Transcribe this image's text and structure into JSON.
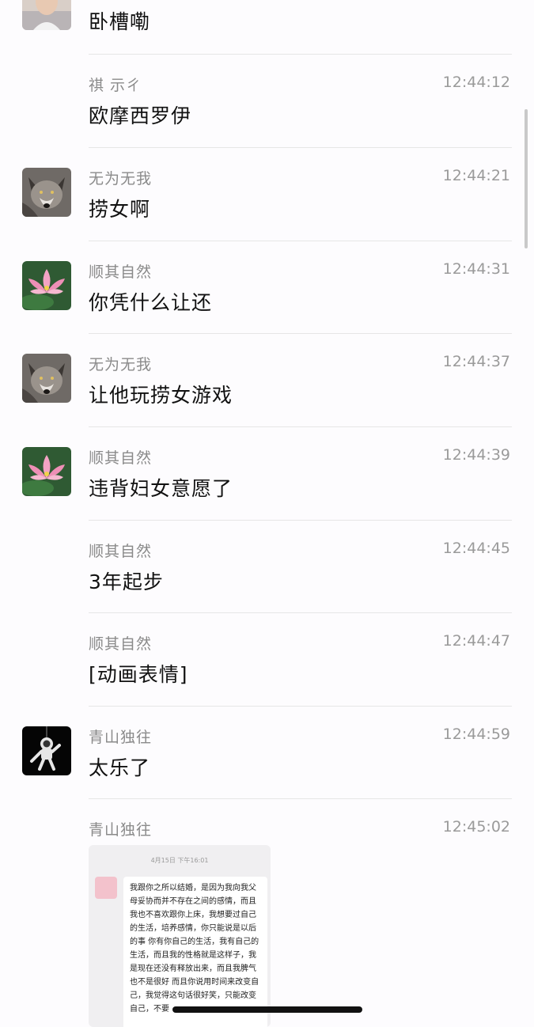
{
  "messages": [
    {
      "sender": "",
      "time": "",
      "text": "卧槽嘞",
      "avatar": "man-photo-avatar"
    },
    {
      "sender": "祺 示ㄔ",
      "time": "12:44:12",
      "text": "欧摩西罗伊",
      "avatar": ""
    },
    {
      "sender": "无为无我",
      "time": "12:44:21",
      "text": "捞女啊",
      "avatar": "wolf-avatar"
    },
    {
      "sender": "顺其自然",
      "time": "12:44:31",
      "text": "你凭什么让还",
      "avatar": "lotus-avatar"
    },
    {
      "sender": "无为无我",
      "time": "12:44:37",
      "text": "让他玩捞女游戏",
      "avatar": "wolf-avatar"
    },
    {
      "sender": "顺其自然",
      "time": "12:44:39",
      "text": "违背妇女意愿了",
      "avatar": "lotus-avatar"
    },
    {
      "sender": "顺其自然",
      "time": "12:44:45",
      "text": "3年起步",
      "avatar": ""
    },
    {
      "sender": "顺其自然",
      "time": "12:44:47",
      "text": "[动画表情]",
      "avatar": ""
    },
    {
      "sender": "青山独往",
      "time": "12:44:59",
      "text": "太乐了",
      "avatar": "astronaut-avatar"
    },
    {
      "sender": "青山独往",
      "time": "12:45:02",
      "text": "",
      "avatar": ""
    }
  ],
  "image_card": {
    "timestamp": "4月15日 下午16:01",
    "text": "我跟你之所以结婚，是因为我向我父母妥协而并不存在之间的感情，而且我也不喜欢跟你上床，我想要过自己的生活，培养感情，你只能说是以后的事 你有你自己的生活，我有自己的生活，而且我的性格就是这样子，我是现在还没有释放出来，而且我脾气也不是很好 而且你说用时间来改变自己，我觉得这句话很好笑，只能改变自己，不要"
  },
  "colors": {
    "background": "#fdfcfe",
    "sender": "#8a8a8a",
    "time": "#9a9a9a",
    "divider": "#e6e6e6"
  }
}
